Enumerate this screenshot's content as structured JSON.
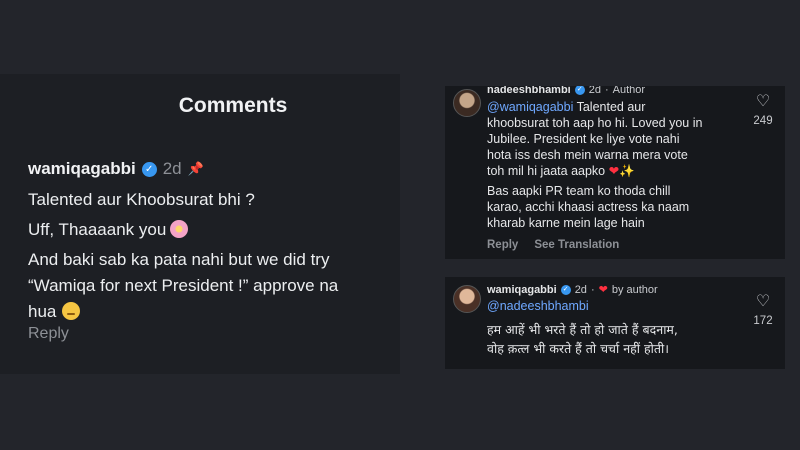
{
  "left_comment": {
    "title": "Comments",
    "username": "wamiqagabbi",
    "time": "2d",
    "lines": [
      "Talented aur Khoobsurat bhi ?",
      "Uff, Thaaaank you",
      "And baki sab ka pata nahi but we did try",
      "“Wamiqa for next President !” approve na",
      "hua"
    ],
    "reply_label": "Reply",
    "icons": [
      "verified-icon",
      "pin-icon",
      "cherry-blossom-emoji",
      "pensive-face-emoji"
    ]
  },
  "right_comment": {
    "username": "nadeeshbhambi",
    "time": "2d",
    "role": "Author",
    "mention": "@wamiqagabbi",
    "lines": [
      "Talented aur",
      "khoobsurat toh aap ho hi. Loved you in",
      "Jubilee. President ke liye vote nahi",
      "hota iss desh mein warna mera vote",
      "toh mil hi jaata aapko",
      "Bas aapki PR team ko thoda chill",
      "karao, acchi khaasi actress ka naam",
      "kharab karne mein lage hain"
    ],
    "reply_label": "Reply",
    "translation_label": "See Translation",
    "likes": "249",
    "icons": [
      "verified-icon",
      "heart-outline-icon",
      "red-heart-emoji",
      "sparkles-emoji"
    ]
  },
  "reply_comment": {
    "username": "wamiqagabbi",
    "time": "2d",
    "by_author": "by author",
    "mention": "@nadeeshbhambi",
    "lines": [
      "हम आहें भी भरते हैं तो हो जाते हैं बदनाम,",
      "वोह क़त्ल भी करते हैं तो चर्चा नहीं होती।"
    ],
    "likes": "172",
    "icons": [
      "verified-icon",
      "red-heart-icon",
      "heart-outline-icon"
    ]
  }
}
